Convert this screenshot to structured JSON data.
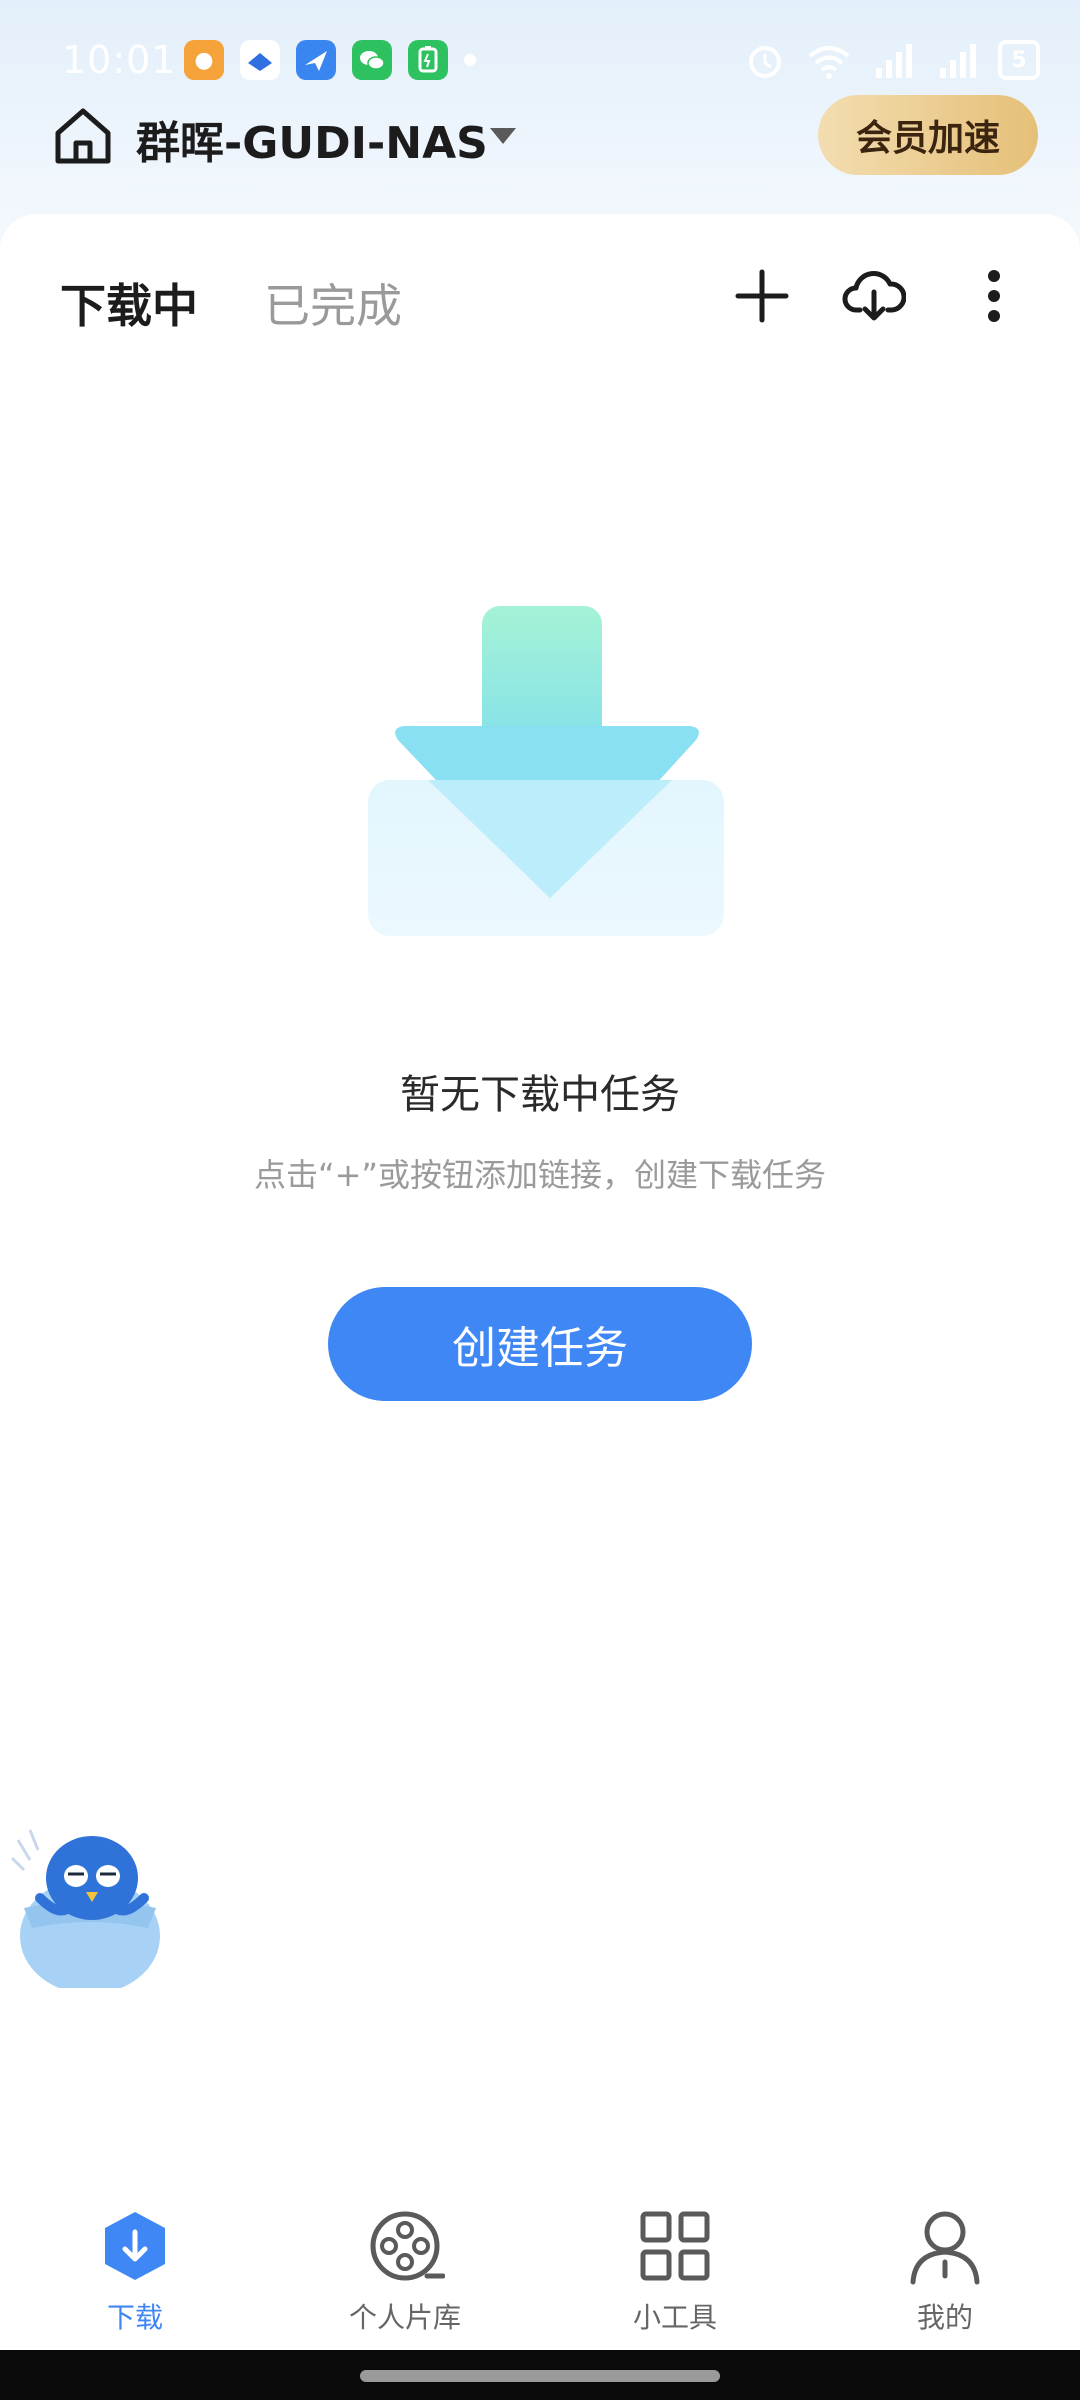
{
  "status_bar": {
    "time": "10:01",
    "battery_level": "5",
    "app_icons": [
      "app-icon-orange",
      "app-icon-blue-book",
      "app-icon-blue-bird",
      "wechat-icon",
      "battery-saver-icon"
    ]
  },
  "header": {
    "device_name": "群晖-GUDI-NAS",
    "vip_button_label": "会员加速"
  },
  "tabs": [
    {
      "label": "下载中",
      "active": true
    },
    {
      "label": "已完成",
      "active": false
    }
  ],
  "empty_state": {
    "title": "暂无下载中任务",
    "hint": "点击“+”或按钮添加链接，创建下载任务",
    "button_label": "创建任务"
  },
  "bottom_nav": [
    {
      "label": "下载",
      "icon": "download-icon",
      "active": true
    },
    {
      "label": "个人片库",
      "icon": "film-reel-icon",
      "active": false
    },
    {
      "label": "小工具",
      "icon": "grid-icon",
      "active": false
    },
    {
      "label": "我的",
      "icon": "person-icon",
      "active": false
    }
  ],
  "colors": {
    "accent": "#3f87f5",
    "vip_gold_start": "#f3ddb0",
    "vip_gold_end": "#e5c078"
  }
}
